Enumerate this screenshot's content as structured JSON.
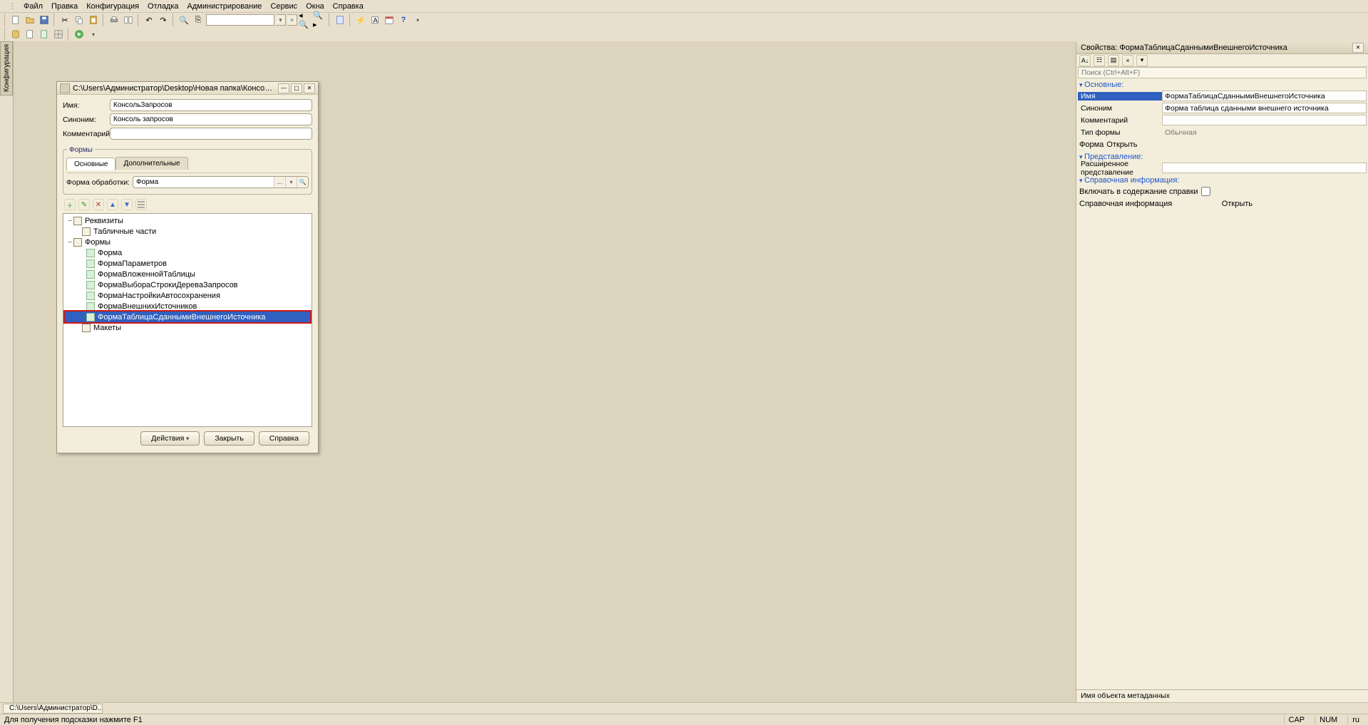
{
  "menu": [
    "Файл",
    "Правка",
    "Конфигурация",
    "Отладка",
    "Администрирование",
    "Сервис",
    "Окна",
    "Справка"
  ],
  "sideTab": "Конфигурация",
  "dialog": {
    "title": "C:\\Users\\Администратор\\Desktop\\Новая папка\\КонсольЗапро...",
    "fields": {
      "nameLabel": "Имя:",
      "nameValue": "КонсольЗапросов",
      "synLabel": "Синоним:",
      "synValue": "Консоль запросов",
      "commLabel": "Комментарий:",
      "commValue": ""
    },
    "formsLegend": "Формы",
    "tabs": {
      "main": "Основные",
      "extra": "Дополнительные"
    },
    "procLabel": "Форма обработки:",
    "procValue": "Форма",
    "tree": {
      "root1exp": "−",
      "root1": "Реквизиты",
      "tab": "Табличные части",
      "formsExp": "−",
      "forms": "Формы",
      "f1": "Форма",
      "f2": "ФормаПараметров",
      "f3": "ФормаВложеннойТаблицы",
      "f4": "ФормаВыбораСтрокиДереваЗапросов",
      "f5": "ФормаНастройкиАвтосохранения",
      "f6": "ФормаВнешнихИсточников",
      "f7": "ФормаТаблицаСданнымиВнешнегоИсточника",
      "mak": "Макеты"
    },
    "buttons": {
      "actions": "Действия",
      "close": "Закрыть",
      "help": "Справка"
    }
  },
  "props": {
    "title": "Свойства: ФормаТаблицаСданнымиВнешнегоИсточника",
    "searchPH": "Поиск (Ctrl+Alt+F)",
    "sections": {
      "main": "Основные:",
      "view": "Представление:",
      "ref": "Справочная информация:"
    },
    "labels": {
      "name": "Имя",
      "syn": "Синоним",
      "comm": "Комментарий",
      "type": "Тип формы",
      "form": "Форма",
      "open": "Открыть",
      "extView": "Расширенное представление",
      "inclHelp": "Включать в содержание справки",
      "refInfo": "Справочная информация"
    },
    "values": {
      "name": "ФормаТаблицаСданнымиВнешнегоИсточника",
      "syn": "Форма таблица сданными внешнего источника",
      "comm": "",
      "type": "Обычная",
      "extView": ""
    },
    "hint": "Имя объекта метаданных"
  },
  "taskbar": {
    "item": "C:\\Users\\Администратор\\D..."
  },
  "status": {
    "hint": "Для получения подсказки нажмите F1",
    "cap": "CAP",
    "num": "NUM",
    "lang": "ru"
  }
}
